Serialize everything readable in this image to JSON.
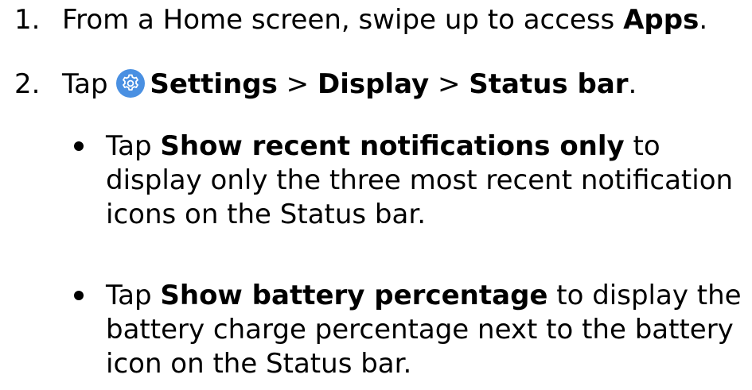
{
  "step1": {
    "number": "1.",
    "text_before": "From a Home screen, swipe up to access ",
    "bold": "Apps",
    "text_after": "."
  },
  "step2": {
    "number": "2.",
    "tap": "Tap",
    "settings": "Settings",
    "sep1": " > ",
    "display": "Display",
    "sep2": " > ",
    "status_bar": "Status bar",
    "period": ".",
    "icon": "settings-gear-icon",
    "icon_color": "#4a90e2"
  },
  "bullets": [
    {
      "tap": "Tap ",
      "bold": "Show recent notifications only",
      "rest": " to display only the three most recent notification icons on the Status bar."
    },
    {
      "tap": "Tap ",
      "bold": "Show battery percentage",
      "rest": " to display the battery charge percentage next to the battery icon on the Status bar."
    }
  ]
}
